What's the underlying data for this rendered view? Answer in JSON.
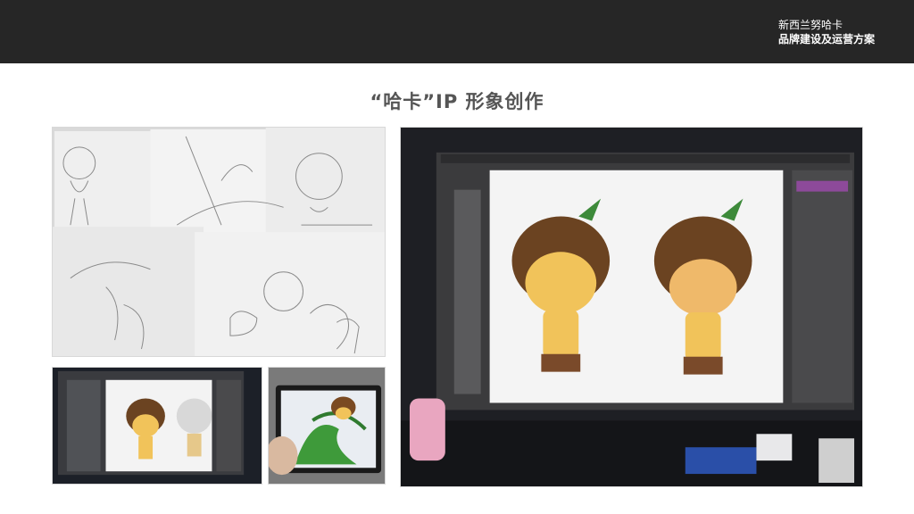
{
  "header": {
    "brand_line1": "新西兰努哈卡",
    "brand_line2": "品牌建设及运营方案"
  },
  "page": {
    "title": "“哈卡”IP 形象创作"
  },
  "colors": {
    "header_bg": "#262626",
    "title": "#555555"
  }
}
